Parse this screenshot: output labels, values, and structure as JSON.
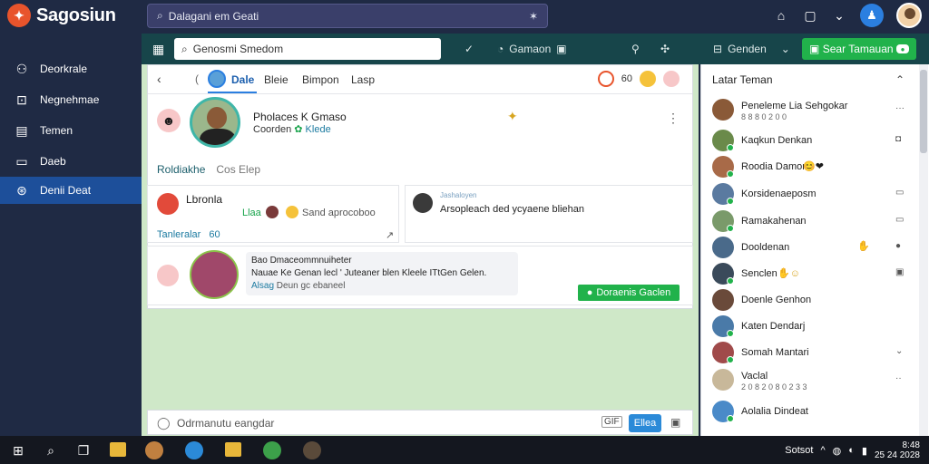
{
  "app": {
    "name": "Sagosiun"
  },
  "top_search": {
    "value": "Dalagani em Geati"
  },
  "sidebar": {
    "items": [
      {
        "label": "Deorkrale",
        "icon": "people-icon"
      },
      {
        "label": "Negnehmae",
        "icon": "message-icon"
      },
      {
        "label": "Temen",
        "icon": "calendar-icon"
      },
      {
        "label": "Daeb",
        "icon": "page-icon"
      },
      {
        "label": "Denii Deat",
        "icon": "globe-icon",
        "active": true
      }
    ]
  },
  "toolbar": {
    "search_value": "Genosmi Smedom",
    "item_label": "Gamaon",
    "right_label": "Genden",
    "cta_label": "Sear Tamauan"
  },
  "tabs": {
    "items": [
      "Dale",
      "Bleie",
      "Bimpon",
      "Lasp"
    ],
    "active_index": 0,
    "count": "60"
  },
  "profile": {
    "name": "Pholaces K Gmaso",
    "sub": "Coorden",
    "sub_green": "Klede",
    "subtab1": "Roldiakhe",
    "subtab2": "Cos Elep"
  },
  "card1": {
    "title": "Lbronla",
    "tag": "Llaa",
    "meta": "Sand aprocoboo",
    "link": "Tanleralar",
    "link_num": "60"
  },
  "card2": {
    "header": "Jashaloyen",
    "text": "Arsopleach ded ycyaene bliehan"
  },
  "card3": {
    "title": "Bao Dmaceommnuiheter",
    "body": "Nauae Ke Genan lecl ' Juteaner blen Kleele ITtGen Gelen.",
    "link": "Alsag",
    "link_rest": "Deun gc ebaneel",
    "button": "Doraenis Gaclen"
  },
  "composer": {
    "placeholder": "Odrmanutu eangdar",
    "gif": "GIF",
    "send": "Ellea"
  },
  "right_panel": {
    "title": "Latar Teman",
    "friends": [
      {
        "name": "Peneleme Lia Sehgokar",
        "sub": "8 8 8 0 2 0 0",
        "color": "#8a5a38"
      },
      {
        "name": "Kaqkun Denkan",
        "sub": "",
        "color": "#6a8a4a"
      },
      {
        "name": "Roodia Damon",
        "sub": "",
        "color": "#a86a48"
      },
      {
        "name": "Korsidenaeposm",
        "sub": "",
        "color": "#5a7aa0"
      },
      {
        "name": "Ramakahenan",
        "sub": "",
        "color": "#7a9a6a"
      },
      {
        "name": "Dooldenan",
        "sub": "",
        "color": "#4a6a8a"
      },
      {
        "name": "Senclen",
        "sub": "",
        "color": "#3a4a5a"
      },
      {
        "name": "Doenle Genhon",
        "sub": "",
        "color": "#6a4a3a"
      },
      {
        "name": "Katen Dendarj",
        "sub": "",
        "color": "#4a7aa8"
      },
      {
        "name": "Somah Mantari",
        "sub": "",
        "color": "#a04a4a"
      },
      {
        "name": "Vaclal",
        "sub": "2 0 8 2 0 8 0 2 3 3",
        "color": "#c8b89a"
      },
      {
        "name": "Aolalia Dindeat",
        "sub": "",
        "color": "#4a8ac8"
      }
    ]
  },
  "taskbar": {
    "tray_label": "Sotsot",
    "time": "8:48",
    "date": "25 24 2028"
  },
  "colors": {
    "nav_bg": "#1f2a44",
    "toolbar_bg": "#17454a",
    "accent_green": "#21b24b",
    "accent_blue": "#2b7fe0"
  }
}
